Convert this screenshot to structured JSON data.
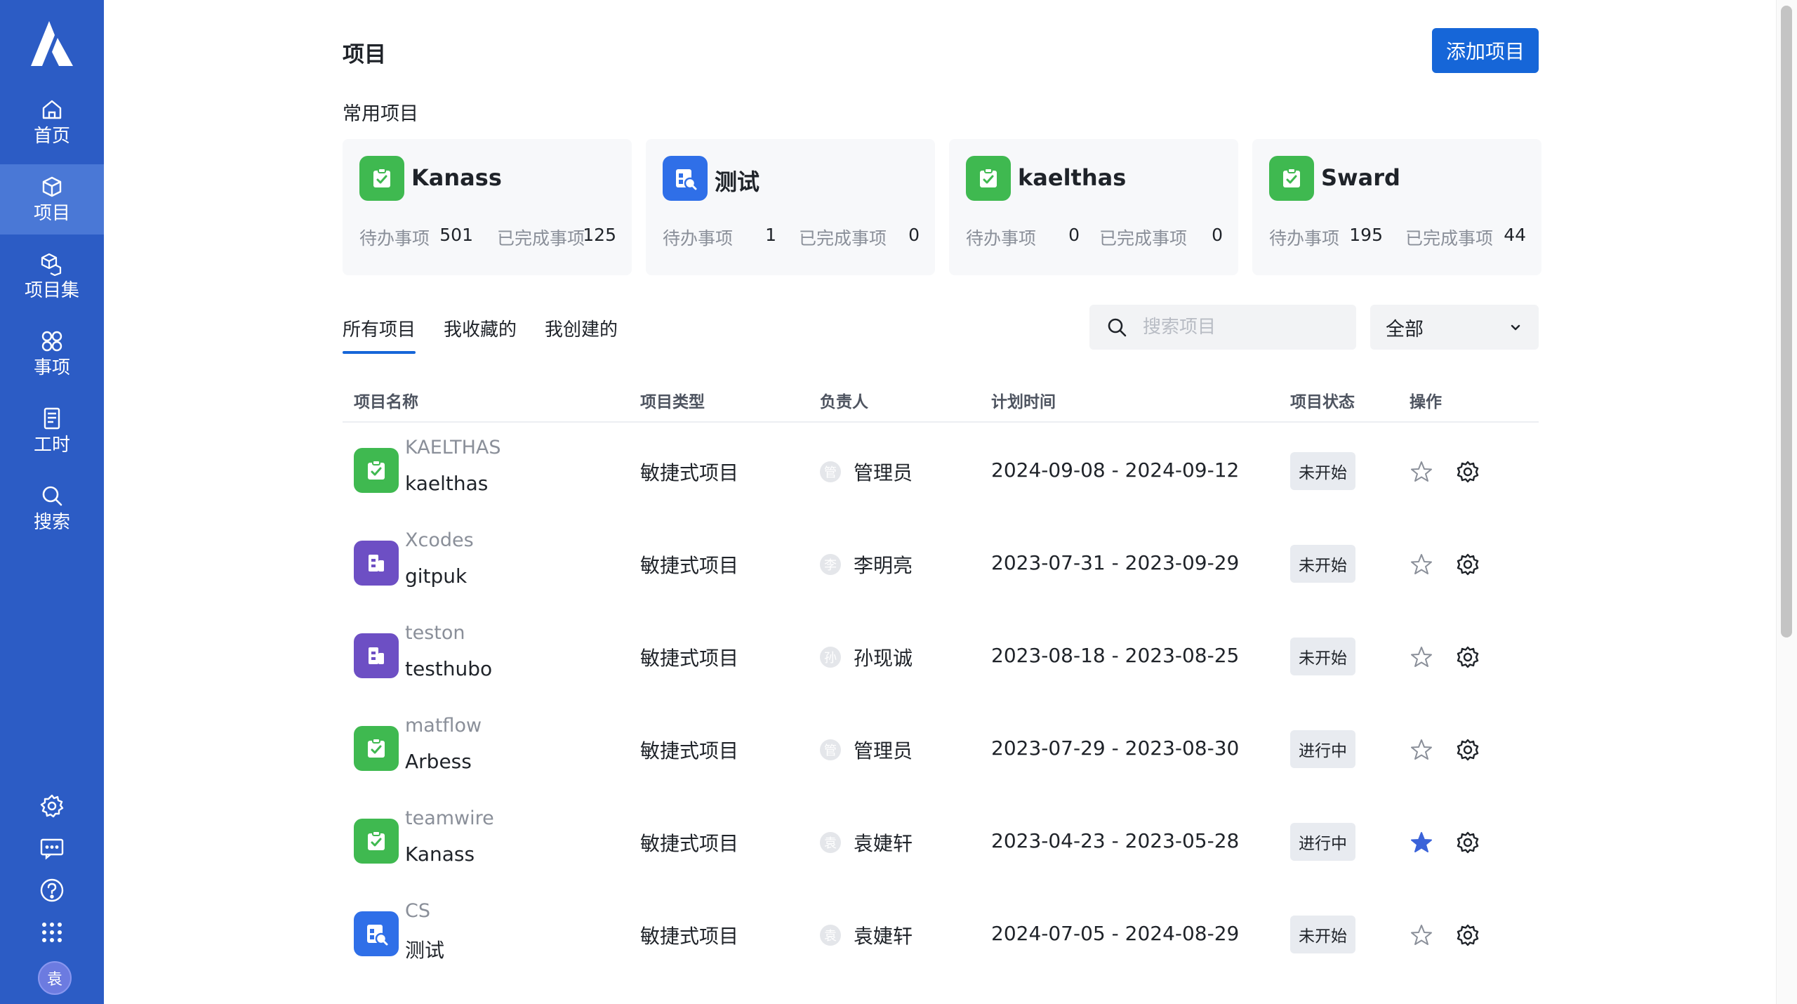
{
  "sidebar": {
    "items": [
      {
        "label": "首页",
        "icon": "home-icon"
      },
      {
        "label": "项目",
        "icon": "cube-icon",
        "active": true
      },
      {
        "label": "项目集",
        "icon": "cubes-icon"
      },
      {
        "label": "事项",
        "icon": "issue-icon"
      },
      {
        "label": "工时",
        "icon": "timesheet-icon"
      },
      {
        "label": "搜索",
        "icon": "search-icon"
      }
    ],
    "tools": [
      "settings-icon",
      "message-icon",
      "help-icon",
      "apps-grid-icon"
    ],
    "avatar": "袁",
    "accent": "#2c5cc5"
  },
  "header": {
    "title": "项目",
    "add_button": "添加项目"
  },
  "frequent": {
    "title": "常用项目",
    "todo_label": "待办事项",
    "done_label": "已完成事项",
    "cards": [
      {
        "name": "Kanass",
        "todo": "501",
        "done": "125",
        "icon": "green-check"
      },
      {
        "name": "测试",
        "todo": "1",
        "done": "0",
        "icon": "blue-test"
      },
      {
        "name": "kaelthas",
        "todo": "0",
        "done": "0",
        "icon": "green-check"
      },
      {
        "name": "Sward",
        "todo": "195",
        "done": "44",
        "icon": "green-check"
      }
    ]
  },
  "tabs": [
    "所有项目",
    "我收藏的",
    "我创建的"
  ],
  "filters": {
    "search_placeholder": "搜索项目",
    "status_select": "全部"
  },
  "table": {
    "columns": [
      "项目名称",
      "项目类型",
      "负责人",
      "计划时间",
      "项目状态",
      "操作"
    ],
    "rows": [
      {
        "key": "KAELTHAS",
        "name": "kaelthas",
        "type": "敏捷式项目",
        "owner_initial": "管",
        "owner": "管理员",
        "date": "2024-09-08 - 2024-09-12",
        "status": "未开始",
        "starred": false,
        "icon": "green-check"
      },
      {
        "key": "Xcodes",
        "name": "gitpuk",
        "type": "敏捷式项目",
        "owner_initial": "李",
        "owner": "李明亮",
        "date": "2023-07-31 - 2023-09-29",
        "status": "未开始",
        "starred": false,
        "icon": "purple-doc"
      },
      {
        "key": "teston",
        "name": "testhubo",
        "type": "敏捷式项目",
        "owner_initial": "孙",
        "owner": "孙现诚",
        "date": "2023-08-18 - 2023-08-25",
        "status": "未开始",
        "starred": false,
        "icon": "purple-doc"
      },
      {
        "key": "matflow",
        "name": "Arbess",
        "type": "敏捷式项目",
        "owner_initial": "管",
        "owner": "管理员",
        "date": "2023-07-29 - 2023-08-30",
        "status": "进行中",
        "starred": false,
        "icon": "green-check"
      },
      {
        "key": "teamwire",
        "name": "Kanass",
        "type": "敏捷式项目",
        "owner_initial": "袁",
        "owner": "袁婕轩",
        "date": "2023-04-23 - 2023-05-28",
        "status": "进行中",
        "starred": true,
        "icon": "green-check"
      },
      {
        "key": "CS",
        "name": "测试",
        "type": "敏捷式项目",
        "owner_initial": "袁",
        "owner": "袁婕轩",
        "date": "2024-07-05 - 2024-08-29",
        "status": "未开始",
        "starred": false,
        "icon": "blue-test"
      }
    ]
  },
  "colors": {
    "primary": "#1666d8",
    "green_icon": "#3fb950",
    "purple_icon": "#6d4fc4",
    "blue_icon": "#2f6fe8",
    "star_active": "#3b63d9"
  }
}
